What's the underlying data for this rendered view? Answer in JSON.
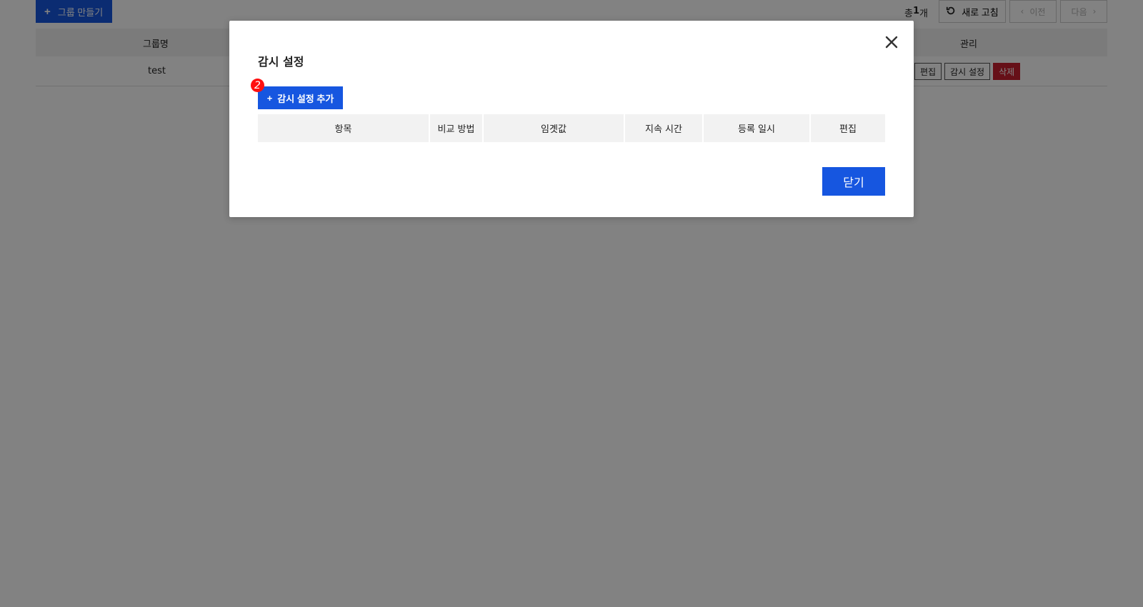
{
  "background": {
    "create_group_button": {
      "icon": "plus-icon",
      "label": "그룹 만들기"
    },
    "total": {
      "prefix": "총",
      "count": "1",
      "suffix": "개"
    },
    "refresh_button": {
      "icon": "refresh-icon",
      "label": "새로 고침"
    },
    "prev_button": {
      "icon": "chevron-left-icon",
      "label": "이전"
    },
    "next_button": {
      "icon": "chevron-right-icon",
      "label": "다음"
    },
    "table": {
      "headers": {
        "group_name": "그룹명",
        "manage": "관리"
      },
      "rows": [
        {
          "group_name": "test",
          "actions": {
            "edit": "편집",
            "monitor": "감시 설정",
            "delete": "삭제"
          }
        }
      ]
    }
  },
  "modal": {
    "title": "감시 설정",
    "badge": "2",
    "add_button": {
      "icon": "plus-icon",
      "label": "감시 설정 추가"
    },
    "table_headers": [
      "항목",
      "비교 방법",
      "임곗값",
      "지속 시간",
      "등록 일시",
      "편집"
    ],
    "close_button": "닫기",
    "close_icon": "close-icon"
  },
  "colors": {
    "primary": "#1656e0",
    "danger": "#c8212f",
    "badge": "#ff1010",
    "overlay": "rgba(0,0,0,0.49)",
    "table_header_bg": "#f2f2f2"
  }
}
